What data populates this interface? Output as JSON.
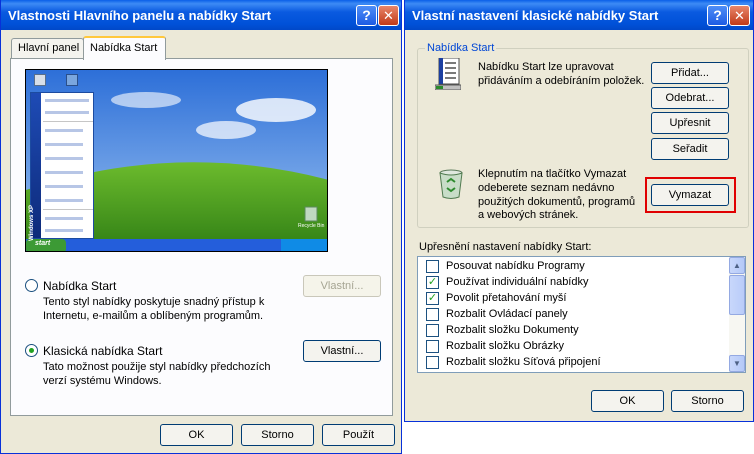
{
  "left_window": {
    "title": "Vlastnosti Hlavního panelu a nabídky Start",
    "tabs": [
      {
        "label": "Hlavní panel",
        "active": false
      },
      {
        "label": "Nabídka Start",
        "active": true
      }
    ],
    "preview": {
      "start_label": "start",
      "recycle_label": "Recycle Bin",
      "sidebar_text": "Windows XP"
    },
    "option_start": {
      "label": "Nabídka Start",
      "selected": false,
      "desc_1": "Tento styl nabídky poskytuje snadný přístup k",
      "desc_2": "Internetu, e-mailům a oblíbeným programům.",
      "button": "Vlastní..."
    },
    "option_classic": {
      "label": "Klasická nabídka Start",
      "selected": true,
      "desc_1": "Tato možnost použije styl nabídky předchozích",
      "desc_2": "verzí systému Windows.",
      "button": "Vlastní..."
    },
    "buttons": {
      "ok": "OK",
      "cancel": "Storno",
      "apply": "Použít"
    }
  },
  "right_window": {
    "title": "Vlastní nastavení klasické nabídky Start",
    "group_label": "Nabídka Start",
    "edit_text_1": "Nabídku Start lze upravovat",
    "edit_text_2": "přidáváním a odebíráním položek.",
    "buttons": {
      "add": "Přidat...",
      "remove": "Odebrat...",
      "advanced": "Upřesnit",
      "sort": "Seřadit",
      "clear": "Vymazat",
      "ok": "OK",
      "cancel": "Storno"
    },
    "clear_text_1": "Klepnutím na tlačítko Vymazat",
    "clear_text_2": "odeberete seznam nedávno",
    "clear_text_3": "použitých dokumentů, programů",
    "clear_text_4": "a webových stránek.",
    "advanced_label": "Upřesnění nastavení nabídky Start:",
    "options": [
      {
        "label": "Posouvat nabídku Programy",
        "checked": false
      },
      {
        "label": "Používat individuální nabídky",
        "checked": true
      },
      {
        "label": "Povolit přetahování myší",
        "checked": true
      },
      {
        "label": "Rozbalit Ovládací panely",
        "checked": false
      },
      {
        "label": "Rozbalit složku Dokumenty",
        "checked": false
      },
      {
        "label": "Rozbalit složku Obrázky",
        "checked": false
      },
      {
        "label": "Rozbalit složku Síťová připojení",
        "checked": false
      }
    ]
  },
  "colors": {
    "title_blue": "#0a5ae0",
    "dialog_bg": "#ece9d8",
    "group_label": "#0046d5",
    "highlight_red": "#e00000",
    "check_green": "#21a121"
  },
  "icons": [
    "help-icon",
    "close-icon",
    "start-menu-icon",
    "recycle-bin-icon",
    "check-icon",
    "scroll-up-icon",
    "scroll-down-icon"
  ]
}
